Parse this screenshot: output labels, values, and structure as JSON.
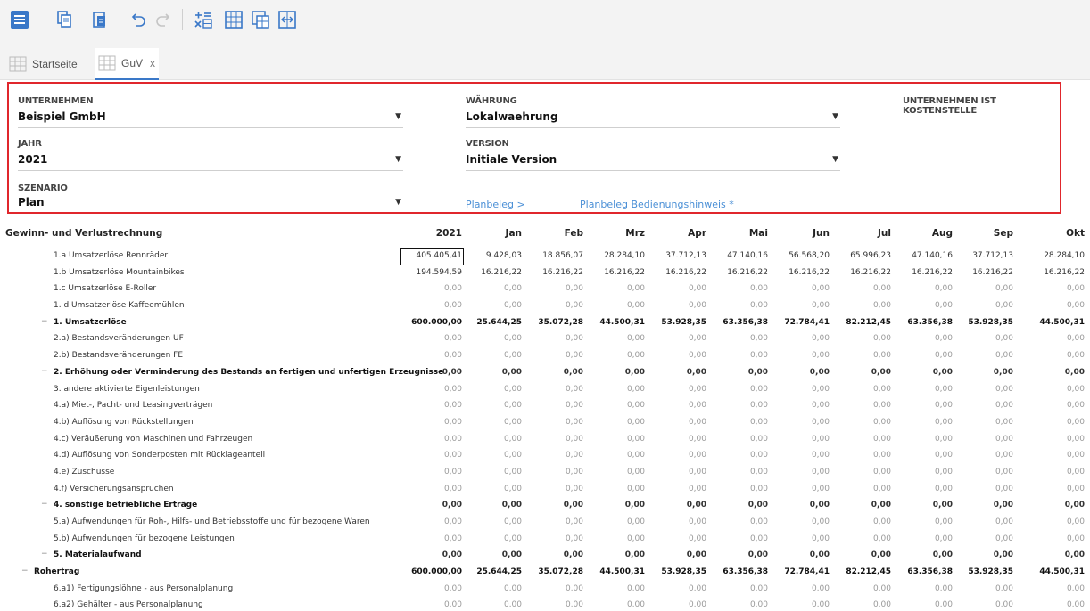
{
  "toolbar": {
    "buttons": [
      "menu-icon",
      "copy-icon",
      "paste-icon",
      "undo-icon",
      "redo-icon",
      "formula-icon",
      "table-icon",
      "table-copy-icon",
      "expand-icon"
    ],
    "accent": "#3a78c8"
  },
  "tabs": [
    {
      "label": "Startseite",
      "active": false
    },
    {
      "label": "GuV",
      "active": true,
      "close": "x"
    }
  ],
  "filters": {
    "unternehmen": {
      "label": "UNTERNEHMEN",
      "value": "Beispiel GmbH"
    },
    "waehrung": {
      "label": "WÄHRUNG",
      "value": "Lokalwaehrung"
    },
    "kostenstelle": {
      "label": "UNTERNEHMEN IST KOSTENSTELLE"
    },
    "jahr": {
      "label": "JAHR",
      "value": "2021"
    },
    "version": {
      "label": "VERSION",
      "value": "Initiale Version"
    },
    "szenario": {
      "label": "SZENARIO",
      "value": "Plan"
    },
    "links": [
      "Planbeleg >",
      "Planbeleg Bedienungshinweis *"
    ],
    "border_color": "#e0262c"
  },
  "table": {
    "title": "Gewinn- und Verlustrechnung",
    "columns": [
      "2021",
      "Jan",
      "Feb",
      "Mrz",
      "Apr",
      "Mai",
      "Jun",
      "Jul",
      "Aug",
      "Sep",
      "Okt"
    ],
    "rows": [
      {
        "label": "1.a Umsatzerlöse Rennräder",
        "level": 2,
        "bold": false,
        "values": [
          "405.405,41",
          "9.428,03",
          "18.856,07",
          "28.284,10",
          "37.712,13",
          "47.140,16",
          "56.568,20",
          "65.996,23",
          "47.140,16",
          "37.712,13",
          "28.284,10"
        ]
      },
      {
        "label": "1.b Umsatzerlöse Mountainbikes",
        "level": 2,
        "bold": false,
        "values": [
          "194.594,59",
          "16.216,22",
          "16.216,22",
          "16.216,22",
          "16.216,22",
          "16.216,22",
          "16.216,22",
          "16.216,22",
          "16.216,22",
          "16.216,22",
          "16.216,22"
        ]
      },
      {
        "label": "1.c Umsatzerlöse E-Roller",
        "level": 2,
        "bold": false,
        "values": [
          "0,00",
          "0,00",
          "0,00",
          "0,00",
          "0,00",
          "0,00",
          "0,00",
          "0,00",
          "0,00",
          "0,00",
          "0,00"
        ]
      },
      {
        "label": "1. d Umsatzerlöse Kaffeemühlen",
        "level": 2,
        "bold": false,
        "values": [
          "0,00",
          "0,00",
          "0,00",
          "0,00",
          "0,00",
          "0,00",
          "0,00",
          "0,00",
          "0,00",
          "0,00",
          "0,00"
        ]
      },
      {
        "label": "1. Umsatzerlöse",
        "level": 1,
        "bold": true,
        "values": [
          "600.000,00",
          "25.644,25",
          "35.072,28",
          "44.500,31",
          "53.928,35",
          "63.356,38",
          "72.784,41",
          "82.212,45",
          "63.356,38",
          "53.928,35",
          "44.500,31"
        ]
      },
      {
        "label": "2.a) Bestandsveränderungen UF",
        "level": 2,
        "bold": false,
        "values": [
          "0,00",
          "0,00",
          "0,00",
          "0,00",
          "0,00",
          "0,00",
          "0,00",
          "0,00",
          "0,00",
          "0,00",
          "0,00"
        ]
      },
      {
        "label": "2.b) Bestandsveränderungen FE",
        "level": 2,
        "bold": false,
        "values": [
          "0,00",
          "0,00",
          "0,00",
          "0,00",
          "0,00",
          "0,00",
          "0,00",
          "0,00",
          "0,00",
          "0,00",
          "0,00"
        ]
      },
      {
        "label": "2. Erhöhung oder Verminderung des Bestands an fertigen und unfertigen Erzeugnisse",
        "level": 1,
        "bold": true,
        "values": [
          "0,00",
          "0,00",
          "0,00",
          "0,00",
          "0,00",
          "0,00",
          "0,00",
          "0,00",
          "0,00",
          "0,00",
          "0,00"
        ]
      },
      {
        "label": "3. andere aktivierte Eigenleistungen",
        "level": 2,
        "bold": false,
        "values": [
          "0,00",
          "0,00",
          "0,00",
          "0,00",
          "0,00",
          "0,00",
          "0,00",
          "0,00",
          "0,00",
          "0,00",
          "0,00"
        ]
      },
      {
        "label": "4.a) Miet-, Pacht- und Leasingverträgen",
        "level": 2,
        "bold": false,
        "values": [
          "0,00",
          "0,00",
          "0,00",
          "0,00",
          "0,00",
          "0,00",
          "0,00",
          "0,00",
          "0,00",
          "0,00",
          "0,00"
        ]
      },
      {
        "label": "4.b) Auflösung von Rückstellungen",
        "level": 2,
        "bold": false,
        "values": [
          "0,00",
          "0,00",
          "0,00",
          "0,00",
          "0,00",
          "0,00",
          "0,00",
          "0,00",
          "0,00",
          "0,00",
          "0,00"
        ]
      },
      {
        "label": "4.c) Veräußerung von Maschinen und Fahrzeugen",
        "level": 2,
        "bold": false,
        "values": [
          "0,00",
          "0,00",
          "0,00",
          "0,00",
          "0,00",
          "0,00",
          "0,00",
          "0,00",
          "0,00",
          "0,00",
          "0,00"
        ]
      },
      {
        "label": "4.d) Auflösung von Sonderposten mit Rücklageanteil",
        "level": 2,
        "bold": false,
        "values": [
          "0,00",
          "0,00",
          "0,00",
          "0,00",
          "0,00",
          "0,00",
          "0,00",
          "0,00",
          "0,00",
          "0,00",
          "0,00"
        ]
      },
      {
        "label": "4.e) Zuschüsse",
        "level": 2,
        "bold": false,
        "values": [
          "0,00",
          "0,00",
          "0,00",
          "0,00",
          "0,00",
          "0,00",
          "0,00",
          "0,00",
          "0,00",
          "0,00",
          "0,00"
        ]
      },
      {
        "label": "4.f) Versicherungsansprüchen",
        "level": 2,
        "bold": false,
        "values": [
          "0,00",
          "0,00",
          "0,00",
          "0,00",
          "0,00",
          "0,00",
          "0,00",
          "0,00",
          "0,00",
          "0,00",
          "0,00"
        ]
      },
      {
        "label": "4. sonstige betriebliche Erträge",
        "level": 1,
        "bold": true,
        "values": [
          "0,00",
          "0,00",
          "0,00",
          "0,00",
          "0,00",
          "0,00",
          "0,00",
          "0,00",
          "0,00",
          "0,00",
          "0,00"
        ]
      },
      {
        "label": "5.a) Aufwendungen für Roh-, Hilfs- und Betriebsstoffe und für bezogene Waren",
        "level": 2,
        "bold": false,
        "values": [
          "0,00",
          "0,00",
          "0,00",
          "0,00",
          "0,00",
          "0,00",
          "0,00",
          "0,00",
          "0,00",
          "0,00",
          "0,00"
        ]
      },
      {
        "label": "5.b) Aufwendungen für bezogene Leistungen",
        "level": 2,
        "bold": false,
        "values": [
          "0,00",
          "0,00",
          "0,00",
          "0,00",
          "0,00",
          "0,00",
          "0,00",
          "0,00",
          "0,00",
          "0,00",
          "0,00"
        ]
      },
      {
        "label": "5. Materialaufwand",
        "level": 1,
        "bold": true,
        "values": [
          "0,00",
          "0,00",
          "0,00",
          "0,00",
          "0,00",
          "0,00",
          "0,00",
          "0,00",
          "0,00",
          "0,00",
          "0,00"
        ]
      },
      {
        "label": "Rohertrag",
        "level": 0,
        "bold": true,
        "values": [
          "600.000,00",
          "25.644,25",
          "35.072,28",
          "44.500,31",
          "53.928,35",
          "63.356,38",
          "72.784,41",
          "82.212,45",
          "63.356,38",
          "53.928,35",
          "44.500,31"
        ]
      },
      {
        "label": "6.a1) Fertigungslöhne - aus Personalplanung",
        "level": 2,
        "bold": false,
        "values": [
          "0,00",
          "0,00",
          "0,00",
          "0,00",
          "0,00",
          "0,00",
          "0,00",
          "0,00",
          "0,00",
          "0,00",
          "0,00"
        ]
      },
      {
        "label": "6.a2) Gehälter - aus Personalplanung",
        "level": 2,
        "bold": false,
        "values": [
          "0,00",
          "0,00",
          "0,00",
          "0,00",
          "0,00",
          "0,00",
          "0,00",
          "0,00",
          "0,00",
          "0,00",
          "0,00"
        ]
      }
    ]
  }
}
